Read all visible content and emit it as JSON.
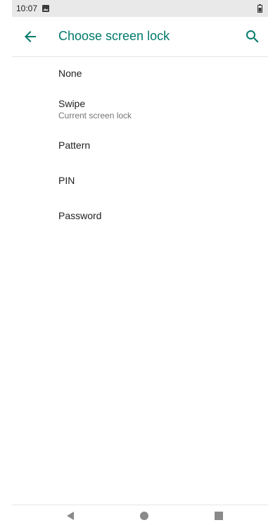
{
  "status_bar": {
    "time": "10:07",
    "icons": [
      "image-notification-icon",
      "battery-icon"
    ]
  },
  "app_bar": {
    "title": "Choose screen lock",
    "back_icon": "arrow-back-icon",
    "search_icon": "search-icon",
    "accent_color": "#00796b"
  },
  "lock_options": [
    {
      "title": "None",
      "subtitle": ""
    },
    {
      "title": "Swipe",
      "subtitle": "Current screen lock"
    },
    {
      "title": "Pattern",
      "subtitle": ""
    },
    {
      "title": "PIN",
      "subtitle": ""
    },
    {
      "title": "Password",
      "subtitle": ""
    }
  ],
  "nav_bar": {
    "icons": [
      "nav-back-icon",
      "nav-home-icon",
      "nav-recents-icon"
    ]
  }
}
